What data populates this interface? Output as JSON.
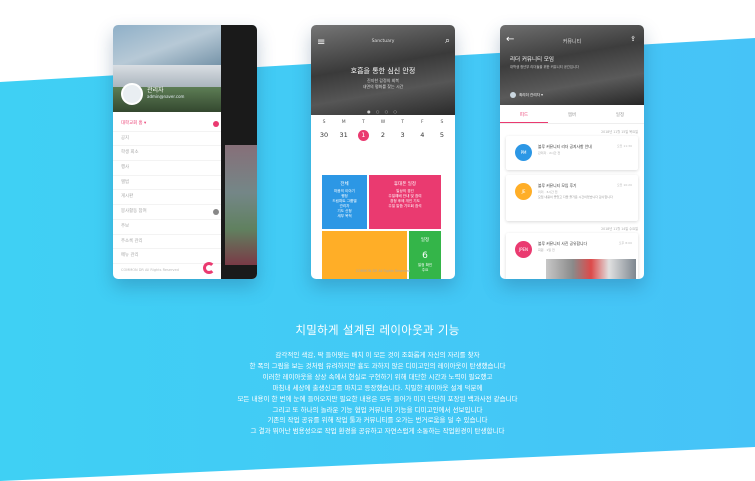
{
  "colors": {
    "accent_pink": "#ea3a70",
    "background_blue": "#3ec8f5",
    "tile_blue": "#2c97e5",
    "tile_pink": "#ea3a70",
    "tile_orange": "#ffae27",
    "tile_green": "#34b549"
  },
  "phone1": {
    "profile_name": "관리자",
    "profile_email": "admin@naver.com",
    "menu_items": [
      {
        "label": "대학교회 홈 ▾",
        "active": true,
        "badge": "pink"
      },
      {
        "label": "공지",
        "active": false,
        "badge": ""
      },
      {
        "label": "학생 회소",
        "active": false,
        "badge": ""
      },
      {
        "label": "행사",
        "active": false,
        "badge": ""
      },
      {
        "label": "앨범",
        "active": false,
        "badge": ""
      },
      {
        "label": "게시판",
        "active": false,
        "badge": ""
      },
      {
        "label": "봉사활동 참여",
        "active": false,
        "badge": "grey"
      },
      {
        "label": "주보",
        "active": false,
        "badge": ""
      },
      {
        "label": "주소록 관리",
        "active": false,
        "badge": ""
      },
      {
        "label": "메뉴 관리",
        "active": false,
        "badge": ""
      }
    ],
    "footer": "COMMON DR All Rights Reserved"
  },
  "phone2": {
    "top_name": "Sanctuary",
    "hero_title": "호흡을 통한 심신 안정",
    "hero_sub": [
      "진지한 감정의 회복",
      "내면의 평화를 찾는 시간"
    ],
    "pager": "● ○ ○ ○",
    "weekdays": [
      "S",
      "M",
      "T",
      "W",
      "T",
      "F",
      "S"
    ],
    "days": [
      "30",
      "31",
      "1",
      "2",
      "3",
      "4",
      "5"
    ],
    "selected_day": "1",
    "tiles": {
      "blue": {
        "title": "전체",
        "text": [
          "마음의 이야기",
          "행정",
          "드림파트 그룹별",
          "관리자",
          "기도 신청",
          "세부 목적",
          "지도자"
        ]
      },
      "pink": {
        "title": "휴대폰 일정",
        "text": [
          "일상의 경건",
          "주일예배 안내 및 참여",
          "경청 후에 개인 기도",
          "주일 말씀 기도회 참석"
        ]
      },
      "orange": {
        "title": ""
      },
      "green": {
        "title": "일정",
        "big": "6",
        "text": [
          "일정 확인",
          "주요"
        ]
      }
    },
    "footer": "COMMON DR All Rights Reserved"
  },
  "phone3": {
    "top_name": "커뮤니티",
    "title": "리더 커뮤니티 모임",
    "desc": "대학생 청년부 리더들을 위한 커뮤니티 공간입니다",
    "user": "최리더 관리자 ▾",
    "tabs": [
      "피드",
      "멤버",
      "일정"
    ],
    "active_tab": "피드",
    "date1": "2018년 11월 15일 목요일",
    "date2": "2018년 11월 14일 수요일",
    "cards": [
      {
        "circle": "PM",
        "circle_color": "#2c97e5",
        "title": "블루 커뮤니티 리더 공지사항 안내",
        "meta": "관리자 · 2시간 전",
        "body": "",
        "time": "오전 11:30"
      },
      {
        "circle": "JE",
        "circle_color": "#ffae27",
        "title": "블루 커뮤니티 모임 후기",
        "meta": "리더 · 3시간 전",
        "body": "모임 내용이 좋았고 다들 즐거운 시간이었습니다 감사합니다",
        "time": "오전 10:20"
      },
      {
        "circle": "JPEN",
        "circle_color": "#ea3a70",
        "title": "블루 커뮤니티 사진 공유합니다",
        "meta": "회원 · 1일 전",
        "body": "",
        "time": "오후 8:00"
      }
    ]
  },
  "section": {
    "title": "치밀하게 설계된 레이아웃과 기능",
    "lines": [
      "감각적인 색감, 딱 들어맞는 배치 이 모든 것이 조화롭게 자신의 자리를 찾자",
      "한 폭의 그림을 보는 것처럼 유려하지만 흉도 과하지 않은 디미고인의 레이아웃이 탄생했습니다",
      "이러한 레이아웃을 상상 속에서 현실로 구현하기 위해 대단한 시간과 노력이 필요했고",
      "마침내 세상에 출생신고를 마치고 등장했습니다. 치밀한 레이아웃 설계 덕분에",
      "모든 내용이 한 번에 눈에 들어오지만 필요한 내용은 모두 들어가 미지 단단히 포장된 백과사전 같습니다",
      "그리고 또 하나의 놀라운 기능 협업 커뮤니티 기능을 디미고인에서 선보입니다",
      "기존의 작업 공유를 위해 작업 툴과 커뮤니티를 오가는 번거로움을 덜 수 있습니다",
      "그 결과 뛰어난 범용성으로 작업 환경을 공유하고 자연스럽게 소통하는 작업환경이 탄생합니다"
    ]
  }
}
